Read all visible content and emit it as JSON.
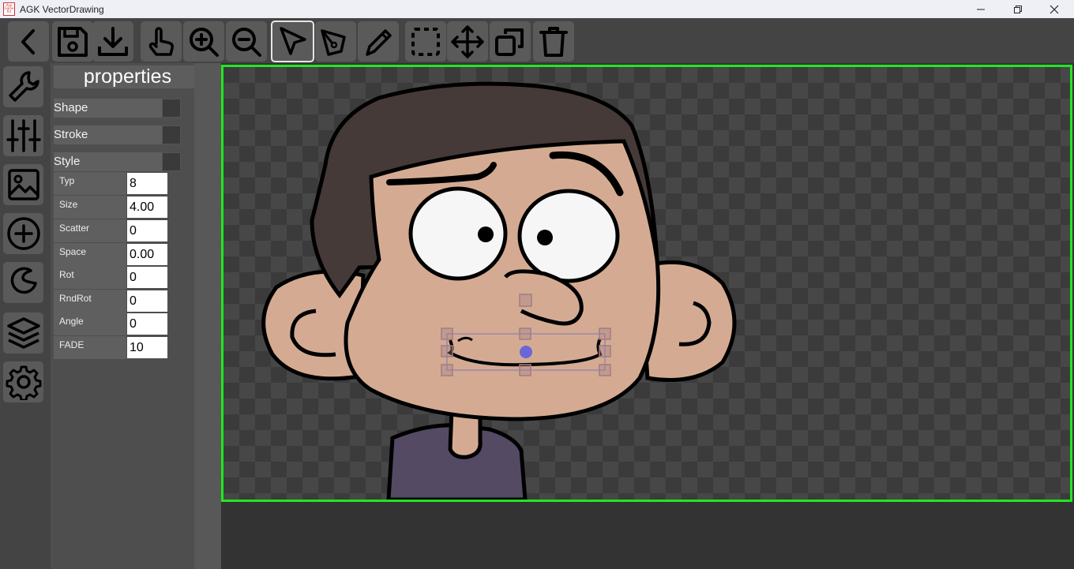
{
  "window": {
    "title": "AGK VectorDrawing",
    "icon_text": "App Game Kit"
  },
  "panel": {
    "title": "properties",
    "sections": [
      {
        "label": "Shape"
      },
      {
        "label": "Stroke"
      },
      {
        "label": "Style"
      }
    ],
    "style_props": [
      {
        "label": "Typ",
        "value": "8"
      },
      {
        "label": "Size",
        "value": "4.00"
      },
      {
        "label": "Scatter",
        "value": "0"
      },
      {
        "label": "Space",
        "value": "0.00"
      },
      {
        "label": "Rot",
        "value": "0"
      },
      {
        "label": "RndRot",
        "value": "0"
      },
      {
        "label": "Angle",
        "value": "0"
      },
      {
        "label": "FADE",
        "value": "10"
      }
    ]
  },
  "colors": {
    "canvas_border": "#22e622",
    "skin": "#d4ab92",
    "hair": "#463a38",
    "shirt": "#544a64",
    "selection": "#7f73b8",
    "handle": "#a07c84",
    "pivot": "#6a66d6"
  },
  "icons": {
    "toolbar": [
      "back-icon",
      "save-icon",
      "download-icon",
      "touch-icon",
      "zoom-in-icon",
      "zoom-out-icon",
      "select-arrow-icon",
      "pen-tool-icon",
      "pencil-icon",
      "marquee-icon",
      "move-icon",
      "duplicate-icon",
      "trash-icon"
    ],
    "rail": [
      "wrench-icon",
      "sliders-icon",
      "image-icon",
      "add-circle-icon",
      "shape-icon",
      "layers-icon",
      "gear-icon"
    ]
  }
}
